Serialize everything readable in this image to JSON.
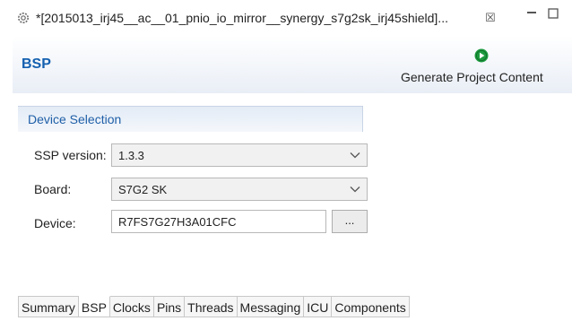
{
  "editor_tab": {
    "title": "*[2015013_irj45__ac__01_pnio_io_mirror__synergy_s7g2sk_irj45shield]...",
    "close_glyph": "☒",
    "icon": "gear-icon"
  },
  "window": {
    "minimize_icon": "minimize-icon",
    "maximize_icon": "maximize-icon"
  },
  "header": {
    "title": "BSP",
    "generate_label": "Generate Project Content",
    "generate_icon": "play-circle-icon"
  },
  "device_selection": {
    "title": "Device Selection",
    "ssp_version": {
      "label": "SSP version:",
      "value": "1.3.3"
    },
    "board": {
      "label": "Board:",
      "value": "S7G2 SK"
    },
    "device": {
      "label": "Device:",
      "value": "R7FS7G27H3A01CFC",
      "browse_label": "..."
    }
  },
  "bottom_tabs": [
    {
      "label": "Summary",
      "active": false
    },
    {
      "label": "BSP",
      "active": true
    },
    {
      "label": "Clocks",
      "active": false
    },
    {
      "label": "Pins",
      "active": false
    },
    {
      "label": "Threads",
      "active": false
    },
    {
      "label": "Messaging",
      "active": false
    },
    {
      "label": "ICU",
      "active": false
    },
    {
      "label": "Components",
      "active": false
    }
  ],
  "colors": {
    "title_blue": "#1460b0",
    "section_blue": "#1f5fa8",
    "generate_green": "#1d9a3e"
  }
}
